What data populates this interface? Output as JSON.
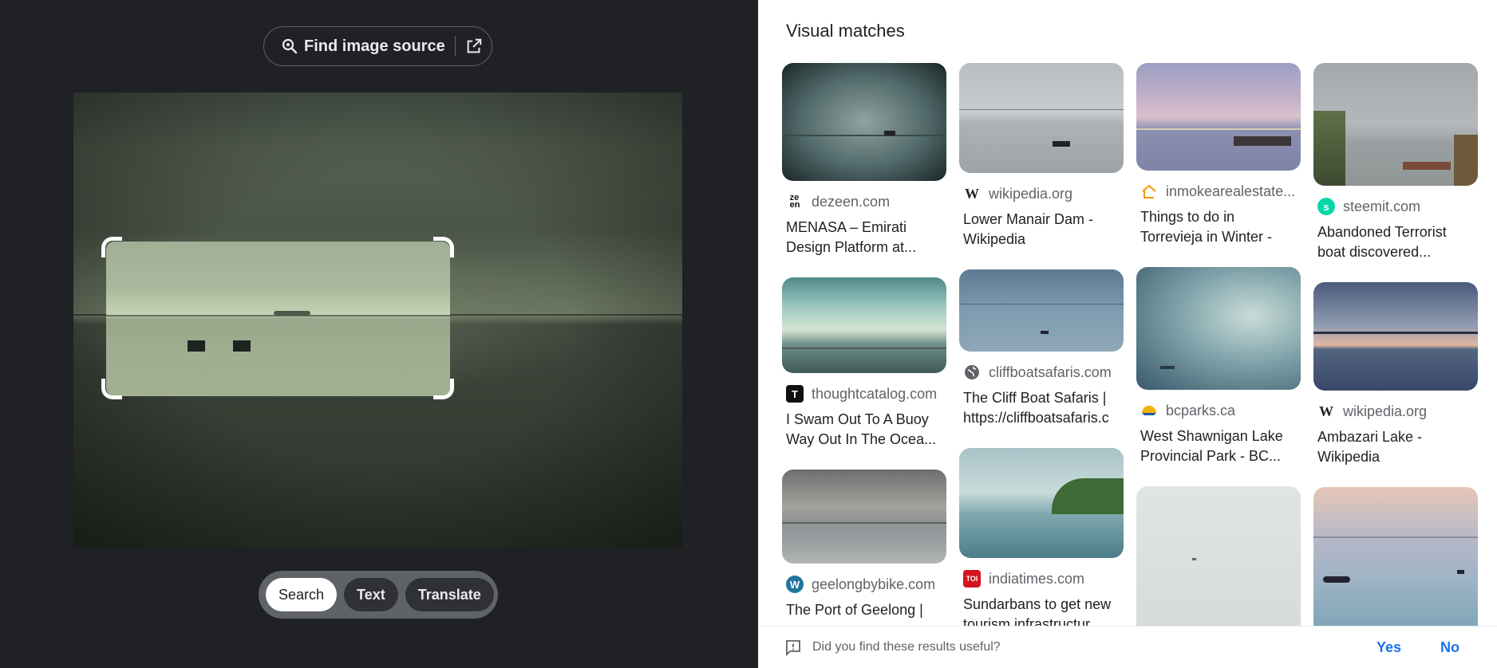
{
  "left": {
    "find_source_label": "Find image source",
    "modes": [
      {
        "label": "Search",
        "active": true
      },
      {
        "label": "Text",
        "active": false
      },
      {
        "label": "Translate",
        "active": false
      }
    ]
  },
  "right": {
    "title": "Visual matches",
    "columns": [
      [
        {
          "site": "dezeen.com",
          "title": "MENASA – Emirati Design Platform at...",
          "icon": "zeen-logo-icon"
        },
        {
          "site": "thoughtcatalog.com",
          "title": "I Swam Out To A Buoy Way Out In The Ocea...",
          "icon": "thoughtcatalog-logo-icon"
        },
        {
          "site": "geelongbybike.com",
          "title": "The Port of Geelong |",
          "icon": "wordpress-logo-icon"
        }
      ],
      [
        {
          "site": "wikipedia.org",
          "title": "Lower Manair Dam - Wikipedia",
          "icon": "wikipedia-logo-icon"
        },
        {
          "site": "cliffboatsafaris.com",
          "title": "The Cliff Boat Safaris | https://cliffboatsafaris.c",
          "icon": "globe-icon"
        },
        {
          "site": "indiatimes.com",
          "title": "Sundarbans to get new tourism infrastructur",
          "icon": "toi-logo-icon"
        }
      ],
      [
        {
          "site": "inmokearealestate...",
          "title": "Things to do in Torrevieja in Winter -",
          "icon": "house-logo-icon"
        },
        {
          "site": "bcparks.ca",
          "title": "West Shawnigan Lake Provincial Park - BC...",
          "icon": "bcparks-logo-icon"
        },
        {
          "site": "",
          "title": "",
          "icon": ""
        }
      ],
      [
        {
          "site": "steemit.com",
          "title": "Abandoned Terrorist boat discovered...",
          "icon": "steemit-logo-icon"
        },
        {
          "site": "wikipedia.org",
          "title": "Ambazari Lake - Wikipedia",
          "icon": "wikipedia-logo-icon"
        },
        {
          "site": "",
          "title": "",
          "icon": ""
        }
      ]
    ],
    "feedback": {
      "question": "Did you find these results useful?",
      "yes": "Yes",
      "no": "No"
    }
  },
  "colors": {
    "dark_bg": "#202124",
    "link_blue": "#1a73e8",
    "muted_text": "#5f6368"
  }
}
